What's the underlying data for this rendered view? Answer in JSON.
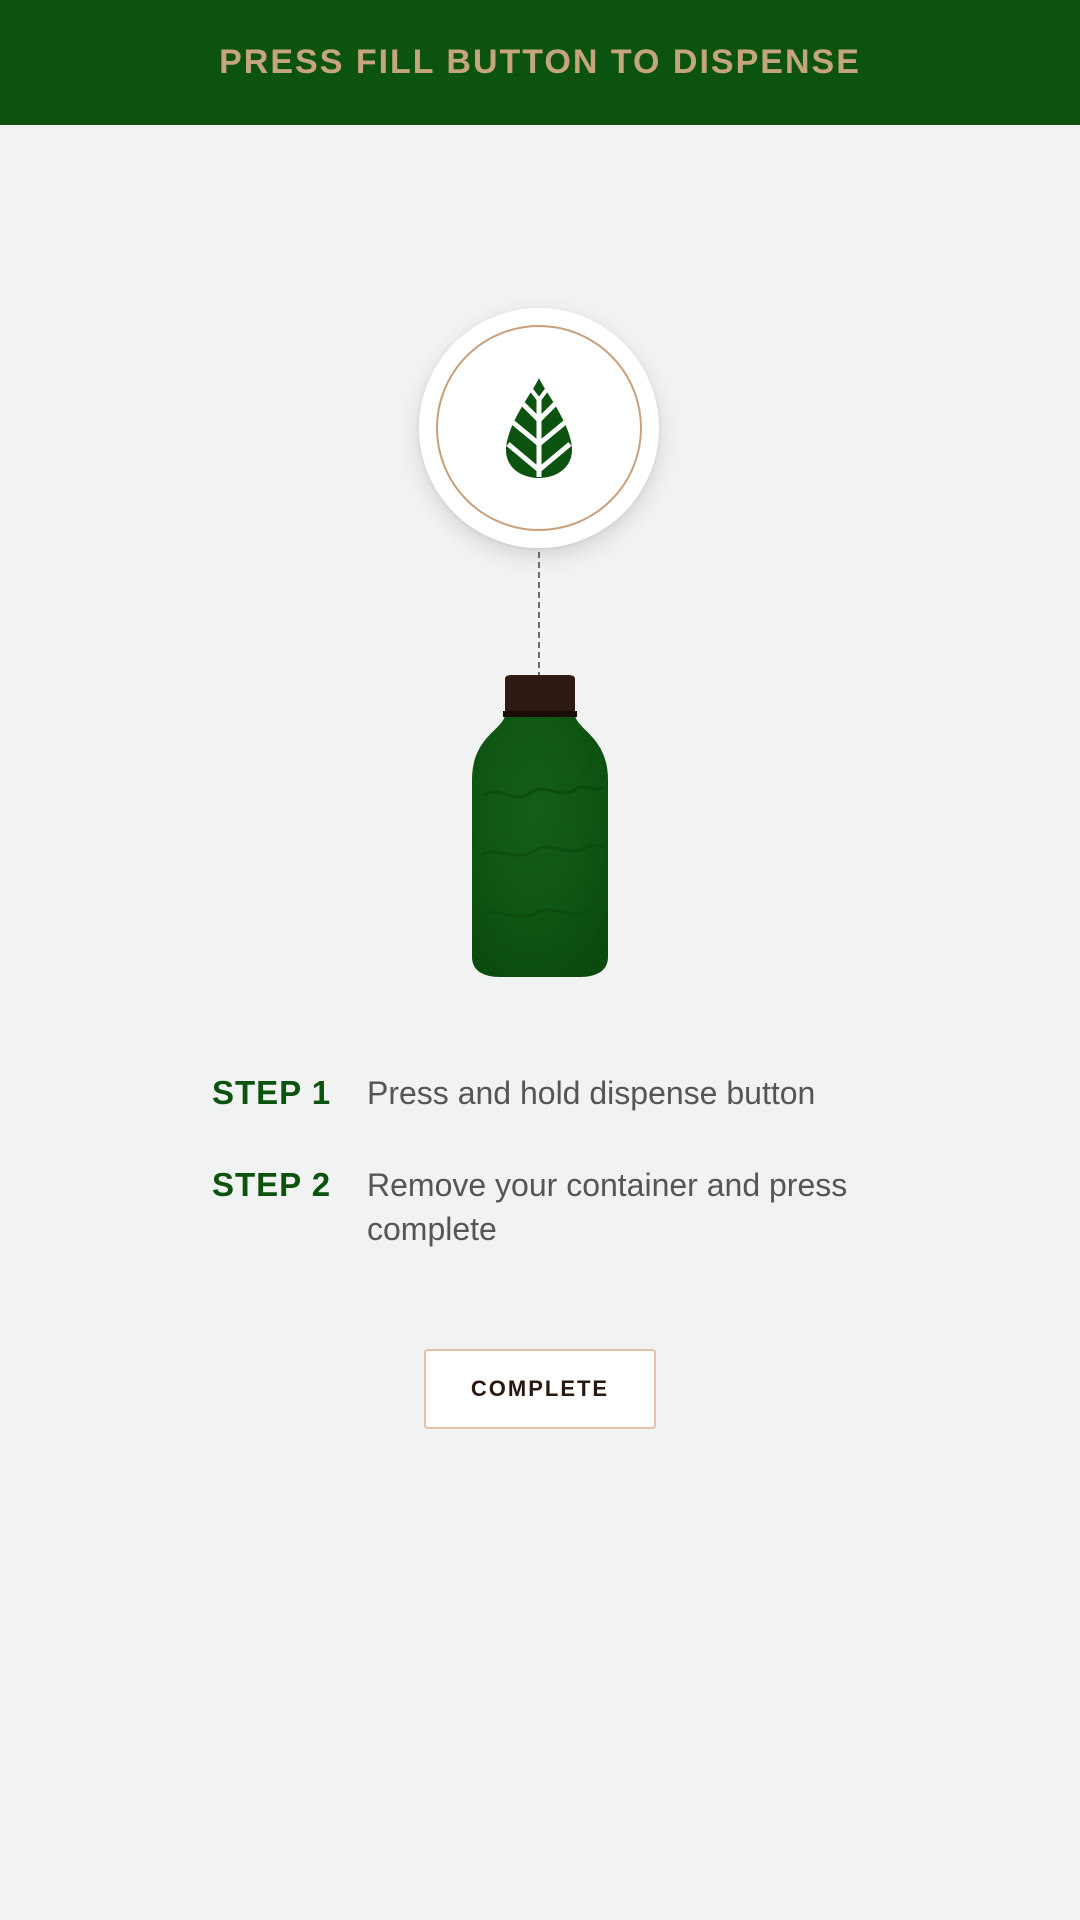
{
  "header": {
    "title": "PRESS FILL BUTTON TO DISPENSE",
    "background_color": "#0c530f",
    "title_color": "#c4a57c"
  },
  "logo": {
    "icon": "leaf-drop-icon",
    "icon_color": "#0c530f",
    "ring_color": "#c9a07e"
  },
  "illustration": {
    "icon": "bottle-icon",
    "bottle_color": "#0c530f",
    "cap_color": "#2e1a12"
  },
  "steps": [
    {
      "label": "STEP 1",
      "text": "Press and hold dispense button"
    },
    {
      "label": "STEP 2",
      "text": "Remove your container and press complete"
    }
  ],
  "complete_button": {
    "label": "COMPLETE"
  }
}
